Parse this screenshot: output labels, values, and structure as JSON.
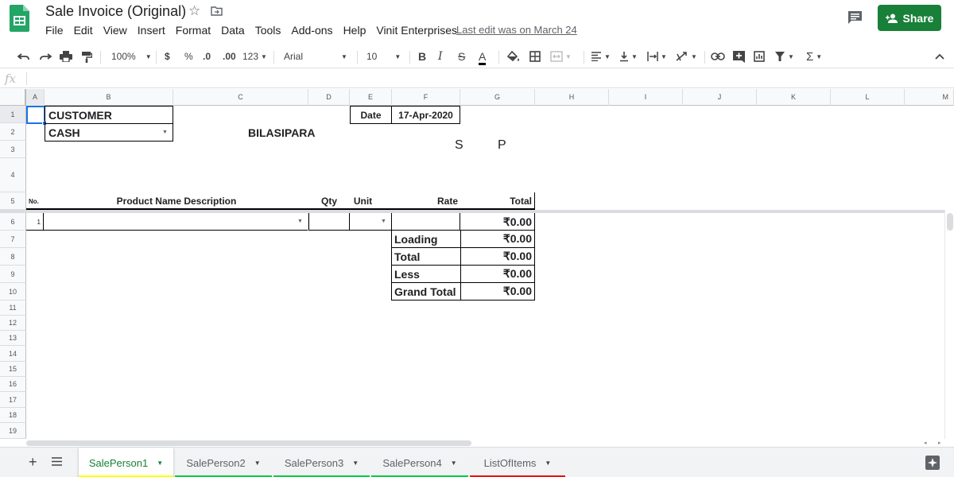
{
  "app": {
    "doc_title": "Sale Invoice (Original)",
    "menu": [
      "File",
      "Edit",
      "View",
      "Insert",
      "Format",
      "Data",
      "Tools",
      "Add-ons",
      "Help",
      "Vinit Enterprises"
    ],
    "last_edit": "Last edit was on March 24",
    "share_label": "Share",
    "accent": "#188038"
  },
  "toolbar": {
    "zoom": "100%",
    "currency": "$",
    "percent": "%",
    "decrease_decimal": ".0",
    "increase_decimal": ".00",
    "more_formats": "123",
    "font": "Arial",
    "font_size": "10",
    "bold": "B",
    "italic": "I",
    "strike": "S",
    "text_color": "A"
  },
  "formula_bar": {
    "fx_label": "fx",
    "value": ""
  },
  "columns": [
    "A",
    "B",
    "C",
    "D",
    "E",
    "F",
    "G",
    "H",
    "I",
    "J",
    "K",
    "L",
    "M"
  ],
  "rows": [
    "1",
    "2",
    "3",
    "4",
    "5",
    "6",
    "7",
    "8",
    "9",
    "10",
    "11",
    "12",
    "13",
    "14",
    "15",
    "16",
    "17",
    "18",
    "19"
  ],
  "invoice": {
    "customer_label": "CUSTOMER",
    "customer_value": "CASH",
    "location": "BILASIPARA",
    "date_label": "Date",
    "date_value": "17-Apr-2020",
    "initial_1": "S",
    "initial_2": "P",
    "headers": {
      "no": "No.",
      "product": "Product Name Description",
      "qty": "Qty",
      "unit": "Unit",
      "rate": "Rate",
      "total": "Total"
    },
    "line": {
      "no": "1",
      "total": "₹0.00"
    },
    "summary": [
      {
        "label": "Loading",
        "value": "₹0.00"
      },
      {
        "label": "Total",
        "value": "₹0.00"
      },
      {
        "label": "Less",
        "value": "₹0.00"
      },
      {
        "label": "Grand Total",
        "value": "₹0.00"
      }
    ]
  },
  "sheets": [
    {
      "name": "SalePerson1",
      "color": "#ffff00",
      "active": true
    },
    {
      "name": "SalePerson2",
      "color": "#00cc44",
      "active": false
    },
    {
      "name": "SalePerson3",
      "color": "#00cc44",
      "active": false
    },
    {
      "name": "SalePerson4",
      "color": "#00cc44",
      "active": false
    },
    {
      "name": "ListOfItems",
      "color": "#ee1111",
      "active": false
    }
  ]
}
